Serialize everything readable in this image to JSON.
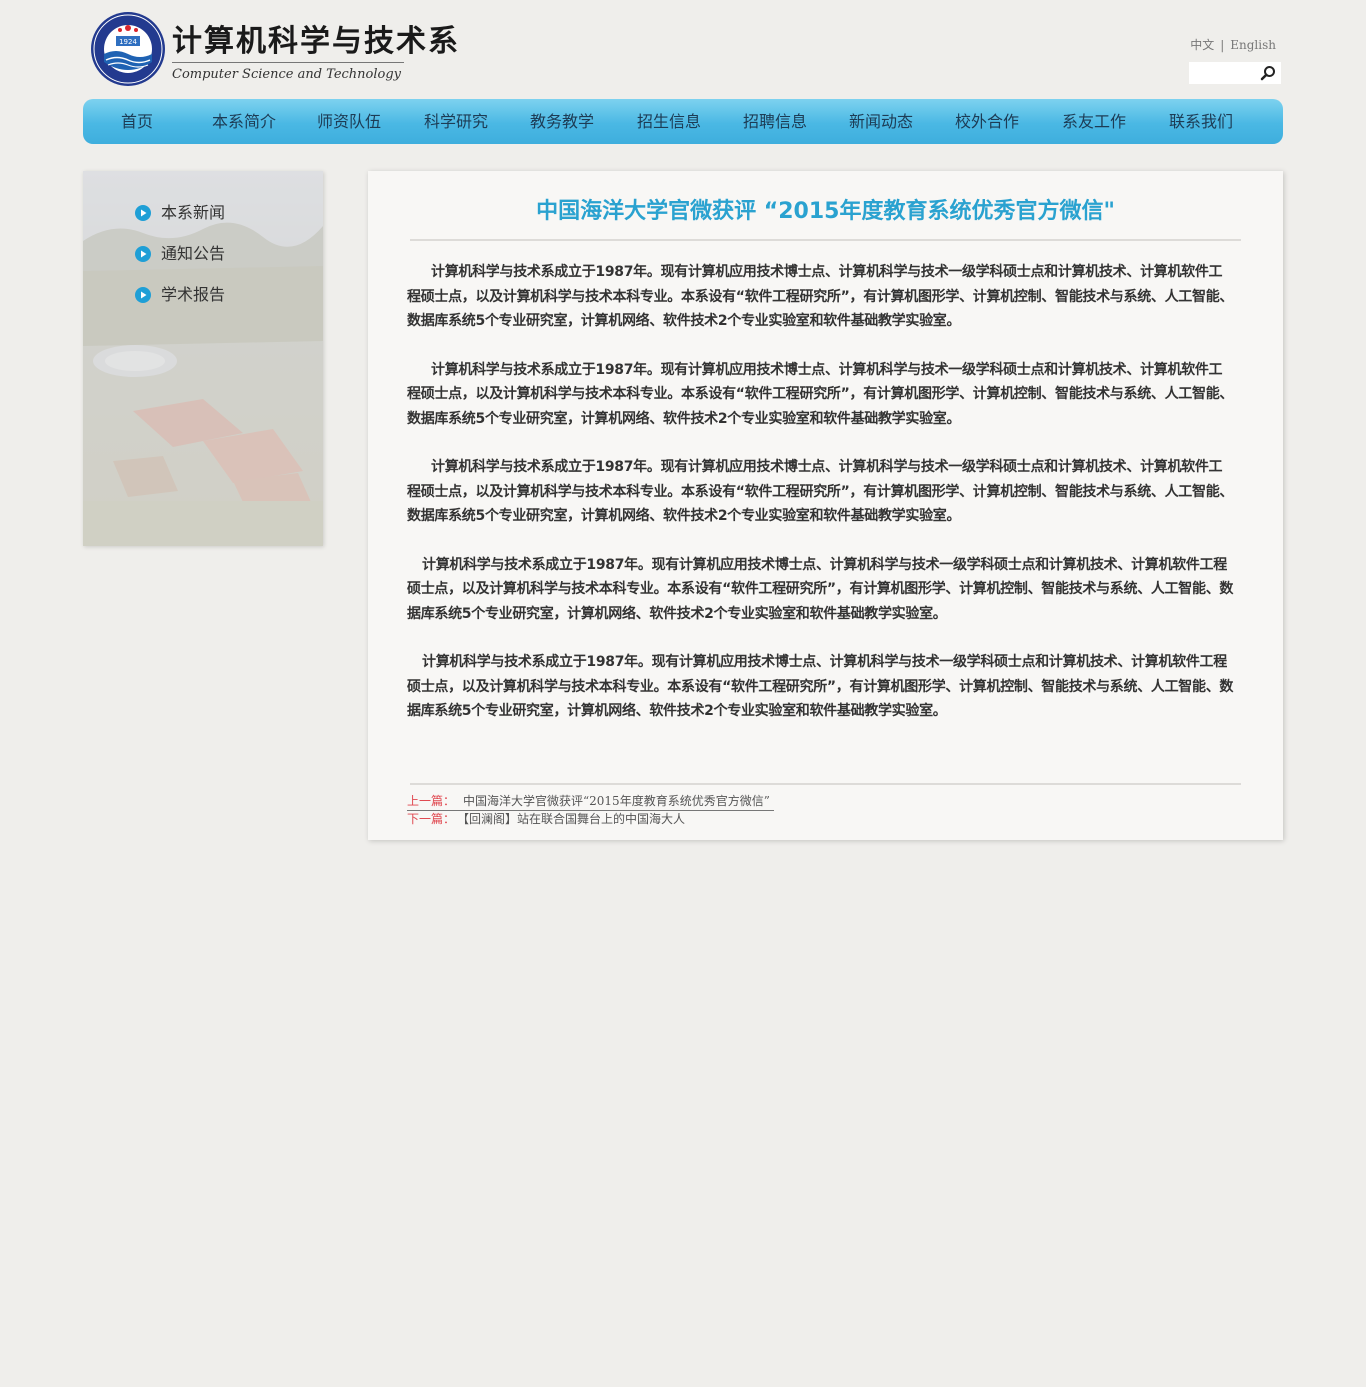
{
  "header": {
    "title_cn": "计算机科学与技术系",
    "title_en": "Computer Science and Technology",
    "seal_year": "1924",
    "seal_text": "OCEAN UNIVERSITY OF CHINA",
    "lang_cn": "中文",
    "lang_sep": "|",
    "lang_en": "English",
    "search_placeholder": ""
  },
  "nav": {
    "items": [
      "首页",
      "本系简介",
      "师资队伍",
      "科学研究",
      "教务教学",
      "招生信息",
      "招聘信息",
      "新闻动态",
      "校外合作",
      "系友工作",
      "联系我们"
    ]
  },
  "sidebar": {
    "items": [
      "本系新闻",
      "通知公告",
      "学术报告"
    ]
  },
  "article": {
    "title": "中国海洋大学官微获评 “2015年度教育系统优秀官方微信\"",
    "paragraphs": [
      "计算机科学与技术系成立于1987年。现有计算机应用技术博士点、计算机科学与技术一级学科硕士点和计算机技术、计算机软件工程硕士点，以及计算机科学与技术本科专业。本系设有“软件工程研究所”，有计算机图形学、计算机控制、智能技术与系统、人工智能、数据库系统5个专业研究室，计算机网络、软件技术2个专业实验室和软件基础教学实验室。",
      "计算机科学与技术系成立于1987年。现有计算机应用技术博士点、计算机科学与技术一级学科硕士点和计算机技术、计算机软件工程硕士点，以及计算机科学与技术本科专业。本系设有“软件工程研究所”，有计算机图形学、计算机控制、智能技术与系统、人工智能、数据库系统5个专业研究室，计算机网络、软件技术2个专业实验室和软件基础教学实验室。",
      "计算机科学与技术系成立于1987年。现有计算机应用技术博士点、计算机科学与技术一级学科硕士点和计算机技术、计算机软件工程硕士点，以及计算机科学与技术本科专业。本系设有“软件工程研究所”，有计算机图形学、计算机控制、智能技术与系统、人工智能、数据库系统5个专业研究室，计算机网络、软件技术2个专业实验室和软件基础教学实验室。",
      "计算机科学与技术系成立于1987年。现有计算机应用技术博士点、计算机科学与技术一级学科硕士点和计算机技术、计算机软件工程硕士点，以及计算机科学与技术本科专业。本系设有“软件工程研究所”，有计算机图形学、计算机控制、智能技术与系统、人工智能、数据库系统5个专业研究室，计算机网络、软件技术2个专业实验室和软件基础教学实验室。",
      "计算机科学与技术系成立于1987年。现有计算机应用技术博士点、计算机科学与技术一级学科硕士点和计算机技术、计算机软件工程硕士点，以及计算机科学与技术本科专业。本系设有“软件工程研究所”，有计算机图形学、计算机控制、智能技术与系统、人工智能、数据库系统5个专业研究室，计算机网络、软件技术2个专业实验室和软件基础教学实验室。"
    ],
    "prev_label": "上一篇：",
    "prev_link": "中国海洋大学官微获评“2015年度教育系统优秀官方微信”",
    "next_label": "下一篇：",
    "next_link": "【回澜阁】站在联合国舞台上的中国海大人"
  },
  "colors": {
    "accent": "#2aa2d0",
    "nav_top": "#7dd2ef",
    "nav_bottom": "#3eaedd",
    "pager_label": "#e0474f",
    "page_bg": "#efeeeb"
  },
  "icons": {
    "search": "search-icon",
    "bullet": "play-circle-icon",
    "logo": "university-seal-logo"
  }
}
